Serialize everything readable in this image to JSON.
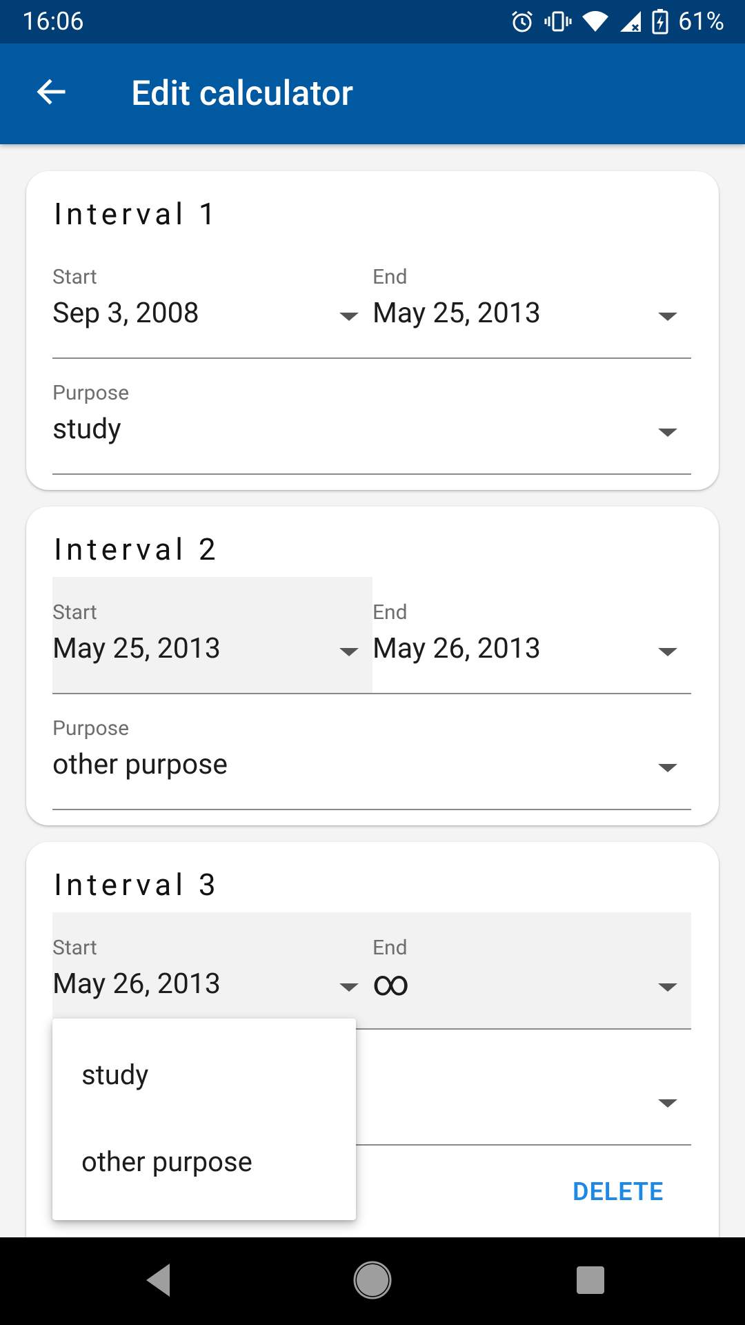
{
  "status_bar": {
    "time": "16:06",
    "battery": "61%",
    "icons": [
      "alarm-icon",
      "vibrate-icon",
      "wifi-icon",
      "signal-icon",
      "battery-charging-icon"
    ]
  },
  "app_bar": {
    "title": "Edit calculator",
    "back_icon": "arrow-back-icon"
  },
  "intervals": [
    {
      "title": "Interval 1",
      "start_label": "Start",
      "start_value": "Sep 3, 2008",
      "end_label": "End",
      "end_value": "May 25, 2013",
      "purpose_label": "Purpose",
      "purpose_value": "study"
    },
    {
      "title": "Interval 2",
      "start_label": "Start",
      "start_value": "May 25, 2013",
      "end_label": "End",
      "end_value": "May 26, 2013",
      "purpose_label": "Purpose",
      "purpose_value": "other purpose"
    },
    {
      "title": "Interval 3",
      "start_label": "Start",
      "start_value": "May 26, 2013",
      "end_label": "End",
      "end_value": "∞",
      "delete_label": "DELETE"
    }
  ],
  "dropdown": {
    "options": [
      "study",
      "other purpose"
    ]
  },
  "nav_bar": {
    "icons": [
      "back-triangle-icon",
      "home-circle-icon",
      "recents-square-icon"
    ]
  },
  "colors": {
    "status_bar": "#003e75",
    "app_bar": "#0159a1",
    "accent": "#1e88e5",
    "background": "#f4f4f4"
  }
}
